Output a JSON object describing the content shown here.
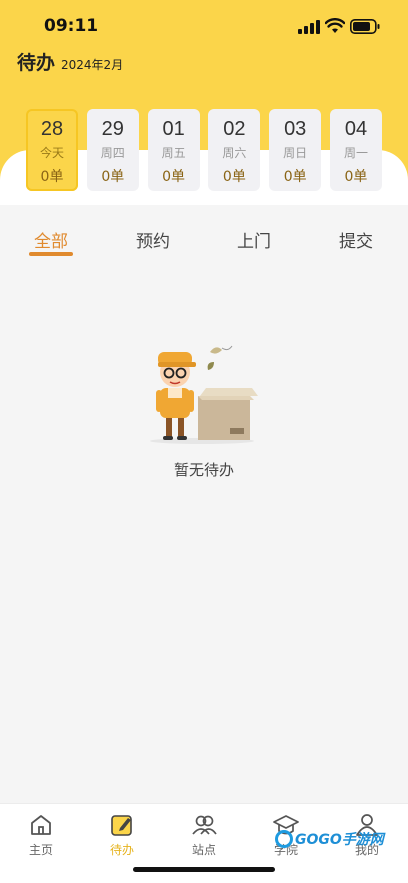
{
  "status_bar": {
    "time": "09:11"
  },
  "header": {
    "title": "待办",
    "month": "2024年2月"
  },
  "dates": [
    {
      "day": "28",
      "weekday": "今天",
      "count": "0单",
      "selected": true
    },
    {
      "day": "29",
      "weekday": "周四",
      "count": "0单",
      "selected": false
    },
    {
      "day": "01",
      "weekday": "周五",
      "count": "0单",
      "selected": false
    },
    {
      "day": "02",
      "weekday": "周六",
      "count": "0单",
      "selected": false
    },
    {
      "day": "03",
      "weekday": "周日",
      "count": "0单",
      "selected": false
    },
    {
      "day": "04",
      "weekday": "周一",
      "count": "0单",
      "selected": false
    }
  ],
  "tabs": [
    {
      "label": "全部",
      "active": true
    },
    {
      "label": "预约",
      "active": false
    },
    {
      "label": "上门",
      "active": false
    },
    {
      "label": "提交",
      "active": false
    }
  ],
  "empty_state": {
    "text": "暂无待办"
  },
  "tabbar": [
    {
      "label": "主页",
      "icon": "home-icon",
      "active": false
    },
    {
      "label": "待办",
      "icon": "todo-icon",
      "active": true
    },
    {
      "label": "站点",
      "icon": "station-icon",
      "active": false
    },
    {
      "label": "学院",
      "icon": "academy-icon",
      "active": false
    },
    {
      "label": "我的",
      "icon": "profile-icon",
      "active": false
    }
  ],
  "watermark": {
    "text": "GOGO手游网"
  },
  "colors": {
    "brand_yellow": "#fbd54a",
    "accent_orange": "#e08a2e",
    "tab_active": "#e6b31e"
  }
}
